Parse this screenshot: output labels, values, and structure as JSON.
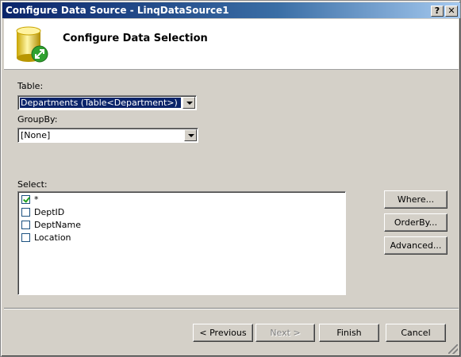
{
  "window": {
    "title": "Configure Data Source - LinqDataSource1",
    "help_label": "?",
    "close_label": "✕"
  },
  "header": {
    "title": "Configure Data Selection",
    "icon": "database-refresh-icon"
  },
  "table": {
    "label": "Table:",
    "value": "Departments (Table<Department>)"
  },
  "groupby": {
    "label": "GroupBy:",
    "value": "[None]"
  },
  "select": {
    "label": "Select:",
    "items": [
      {
        "label": "*",
        "checked": true
      },
      {
        "label": "DeptID",
        "checked": false
      },
      {
        "label": "DeptName",
        "checked": false
      },
      {
        "label": "Location",
        "checked": false
      }
    ]
  },
  "side_buttons": {
    "where": "Where...",
    "orderby": "OrderBy...",
    "advanced": "Advanced..."
  },
  "footer_buttons": {
    "previous": "< Previous",
    "next": "Next >",
    "finish": "Finish",
    "cancel": "Cancel"
  }
}
